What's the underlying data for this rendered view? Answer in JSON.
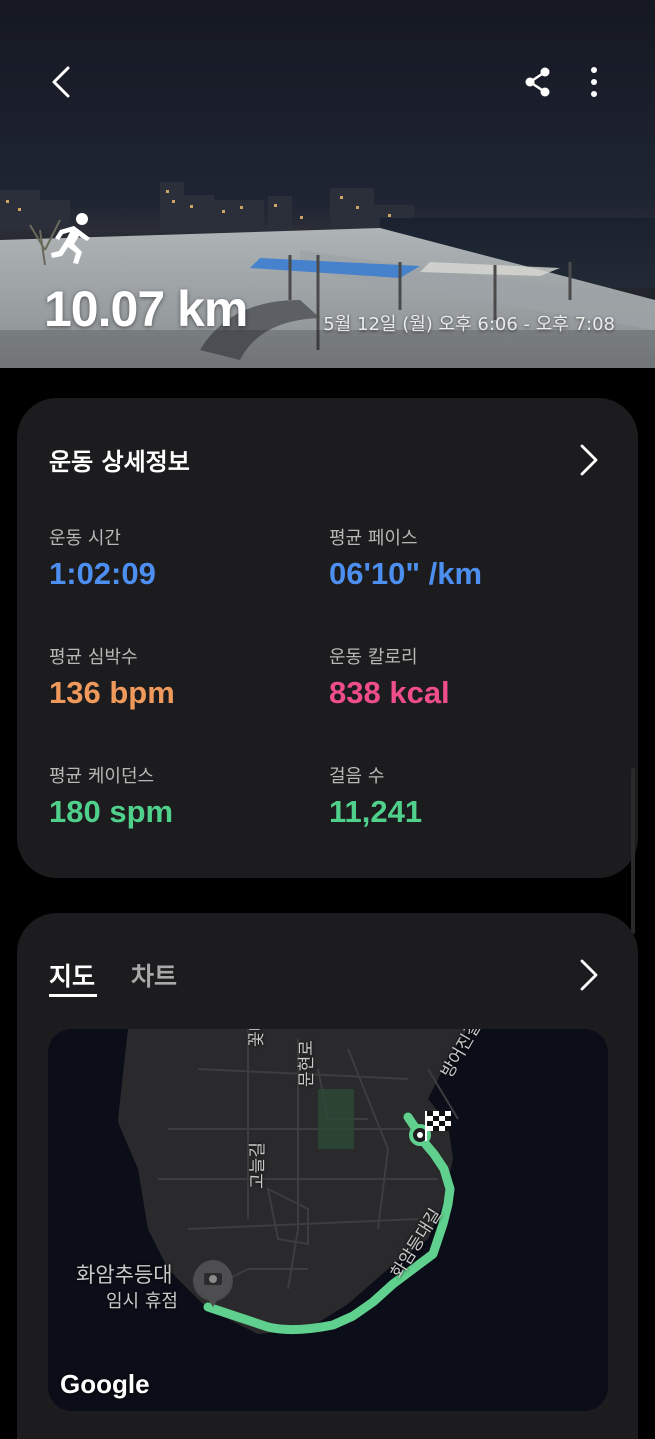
{
  "hero": {
    "distance": "10.07 km",
    "datetime": "5월 12일 (월) 오후 6:06 - 오후 7:08"
  },
  "header_icons": {
    "back": "back-arrow-icon",
    "share": "share-icon",
    "more": "more-vertical-icon"
  },
  "details": {
    "title": "운동 상세정보",
    "stats": [
      {
        "label": "운동 시간",
        "value": "1:02:09",
        "color": "#4c8ff0"
      },
      {
        "label": "평균 페이스",
        "value": "06'10\" /km",
        "color": "#4c8ff0"
      },
      {
        "label": "평균 심박수",
        "value": "136 bpm",
        "color": "#ef9a5c"
      },
      {
        "label": "운동 칼로리",
        "value": "838 kcal",
        "color": "#ef4d8b"
      },
      {
        "label": "평균 케이던스",
        "value": "180 spm",
        "color": "#4fd08b"
      },
      {
        "label": "걸음 수",
        "value": "11,241",
        "color": "#4fd08b"
      }
    ]
  },
  "map_card": {
    "tabs": [
      "지도",
      "차트"
    ],
    "active_tab": "지도",
    "map_labels": {
      "poi_name": "화암추등대",
      "poi_status": "임시 휴점",
      "road_1": "꽃바위로",
      "road_2": "방어진순환도로",
      "road_3": "문현로",
      "road_4": "화암등대길",
      "road_5": "방어진길",
      "road_6": "고늘길"
    },
    "google": "Google",
    "route_color": "#5fd08d"
  }
}
